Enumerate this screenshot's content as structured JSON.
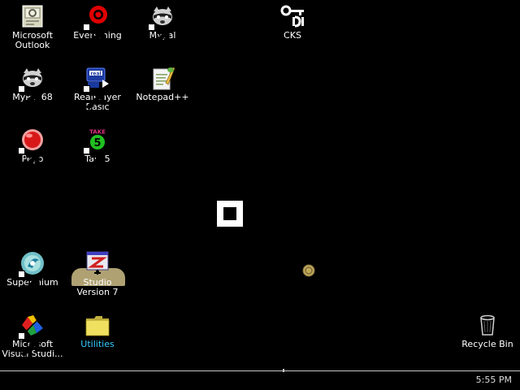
{
  "desktop": {
    "background_color": "#000000",
    "icons": [
      {
        "label": "Microsoft\nOutlook",
        "icon": "outlook-icon"
      },
      {
        "label": "Everything",
        "icon": "everything-icon"
      },
      {
        "label": "Mypal",
        "icon": "mypal-icon"
      },
      {
        "label": "CKS",
        "icon": "cks-icon"
      },
      {
        "label": "MyPal 68",
        "icon": "mypal-68-icon"
      },
      {
        "label": "RealPlayer\nBasic",
        "icon": "realplayer-icon"
      },
      {
        "label": "Notepad++",
        "icon": "notepad-plus-plus-icon"
      },
      {
        "label": "Pego",
        "icon": "pego-icon"
      },
      {
        "label": "Take5",
        "icon": "take5-icon"
      },
      {
        "label": "Supermium",
        "icon": "supermium-icon"
      },
      {
        "label": "Studio\nVersion 7",
        "icon": "studio-icon"
      },
      {
        "label": "Microsoft\nVisual Studi...",
        "icon": "visual-studio-icon"
      },
      {
        "label": "Utilities",
        "icon": "folder-icon",
        "label_color": "#33ccff"
      },
      {
        "label": "Recycle Bin",
        "icon": "recycle-bin-icon"
      }
    ]
  },
  "taskbar": {
    "clock": "5:55 PM",
    "border_color": "#c8c8c8"
  }
}
